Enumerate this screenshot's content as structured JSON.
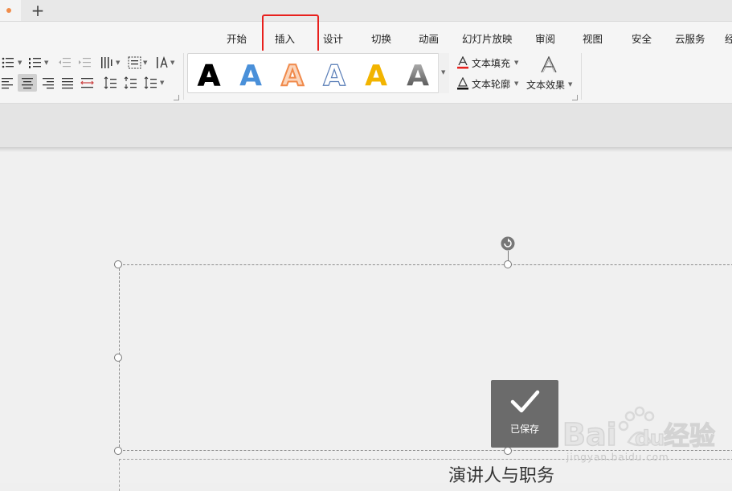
{
  "tabstrip": {
    "new_tab_symbol": "+"
  },
  "menu": {
    "tabs": [
      "开始",
      "插入",
      "设计",
      "切换",
      "动画",
      "幻灯片放映",
      "审阅",
      "视图",
      "安全",
      "云服务",
      "经"
    ],
    "highlighted": "插入",
    "highlight_color": "#e8201d"
  },
  "ribbon": {
    "paragraph_icons_row1": [
      "bullet-list-icon",
      "numbered-list-icon",
      "decrease-indent-icon",
      "increase-indent-icon",
      "columns-icon",
      "text-box-icon",
      "text-direction-icon"
    ],
    "paragraph_icons_row2": [
      "align-left-icon",
      "align-center-icon",
      "align-right-icon",
      "justify-icon",
      "distribute-icon",
      "line-spacing-icon",
      "para-spacing-icon",
      "spacing-options-icon"
    ],
    "art_styles": [
      {
        "glyph": "A",
        "style": "black-shadow",
        "color": "#000000"
      },
      {
        "glyph": "A",
        "style": "blue",
        "color": "#4a90d9"
      },
      {
        "glyph": "A",
        "style": "orange-outline",
        "color": "#f08a4b"
      },
      {
        "glyph": "A",
        "style": "blue-outline",
        "color": "#ffffff"
      },
      {
        "glyph": "A",
        "style": "gold",
        "color": "#f2b400"
      },
      {
        "glyph": "A",
        "style": "gray-gradient",
        "color": "#7a7a7a"
      }
    ],
    "text_fill_label": "文本填充",
    "text_outline_label": "文本轮廓",
    "text_effect_label": "文本效果",
    "dropdown_arrow": "▾"
  },
  "slide": {
    "subtitle": "演讲人与职务"
  },
  "toast": {
    "text": "已保存"
  },
  "watermark": {
    "brand": "Baidu",
    "brand_cn": "经验",
    "url": "jingyan.baidu.com"
  }
}
